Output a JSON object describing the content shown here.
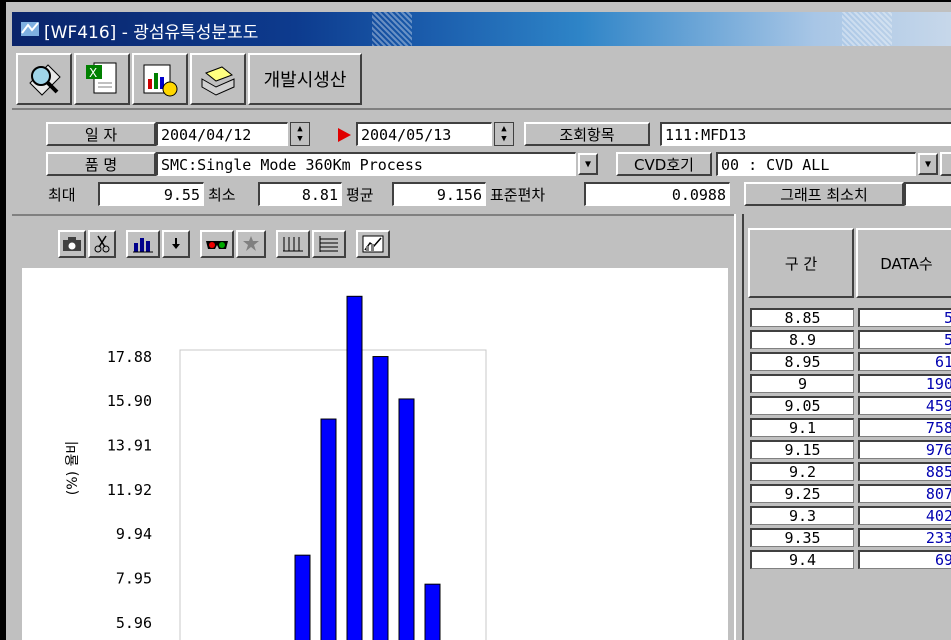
{
  "window": {
    "title": "[WF416] - 광섬유특성분포도"
  },
  "toolbar": {
    "buttons": [
      {
        "icon": "magnifier-icon"
      },
      {
        "icon": "excel-icon"
      },
      {
        "icon": "chart-report-icon"
      },
      {
        "icon": "printer-icon"
      }
    ],
    "dev_label": "개발시생산"
  },
  "form": {
    "date_label": "일  자",
    "date_from": "2004/04/12",
    "date_to": "2004/05/13",
    "query_item_label": "조회항목",
    "query_item_value": "111:MFD13",
    "product_label": "품  명",
    "product_value": "SMC:Single Mode 360Km Process",
    "cvd_label": "CVD호기",
    "cvd_value": "00 : CVD ALL",
    "max_label": "최대",
    "max_value": "9.55",
    "min_label": "최소",
    "min_value": "8.81",
    "avg_label": "평균",
    "avg_value": "9.156",
    "std_label": "표준편차",
    "std_value": "0.0988",
    "graph_min_label": "그래프 최소치",
    "graph_min_value": ""
  },
  "chart_toolbar": [
    {
      "icon": "camera-icon"
    },
    {
      "icon": "scissors-icon"
    },
    {
      "icon": "bar-chart-icon"
    },
    {
      "icon": "dropdown-arrow-icon"
    },
    {
      "icon": "3d-glasses-icon"
    },
    {
      "icon": "pie-icon"
    },
    {
      "icon": "vertical-grid-icon"
    },
    {
      "icon": "horizontal-grid-icon"
    },
    {
      "icon": "chart-style-icon"
    }
  ],
  "chart_data": {
    "type": "bar",
    "ylabel": "(%) 율비",
    "ytick_labels": [
      "17.88",
      "15.90",
      "13.91",
      "11.92",
      "9.94",
      "7.95",
      "5.96"
    ],
    "yticks": [
      17.88,
      15.9,
      13.91,
      11.92,
      9.94,
      7.95,
      5.96
    ],
    "values": [
      9.0,
      15.1,
      20.6,
      17.9,
      16.0,
      7.7
    ],
    "bar_color": "#0000ff"
  },
  "table": {
    "headers": [
      "구 간",
      "DATA수"
    ],
    "rows": [
      [
        "8.85",
        "5"
      ],
      [
        "8.9",
        "5"
      ],
      [
        "8.95",
        "61"
      ],
      [
        "9",
        "190"
      ],
      [
        "9.05",
        "459"
      ],
      [
        "9.1",
        "758"
      ],
      [
        "9.15",
        "976"
      ],
      [
        "9.2",
        "885"
      ],
      [
        "9.25",
        "807"
      ],
      [
        "9.3",
        "402"
      ],
      [
        "9.35",
        "233"
      ],
      [
        "9.4",
        "69"
      ]
    ]
  }
}
